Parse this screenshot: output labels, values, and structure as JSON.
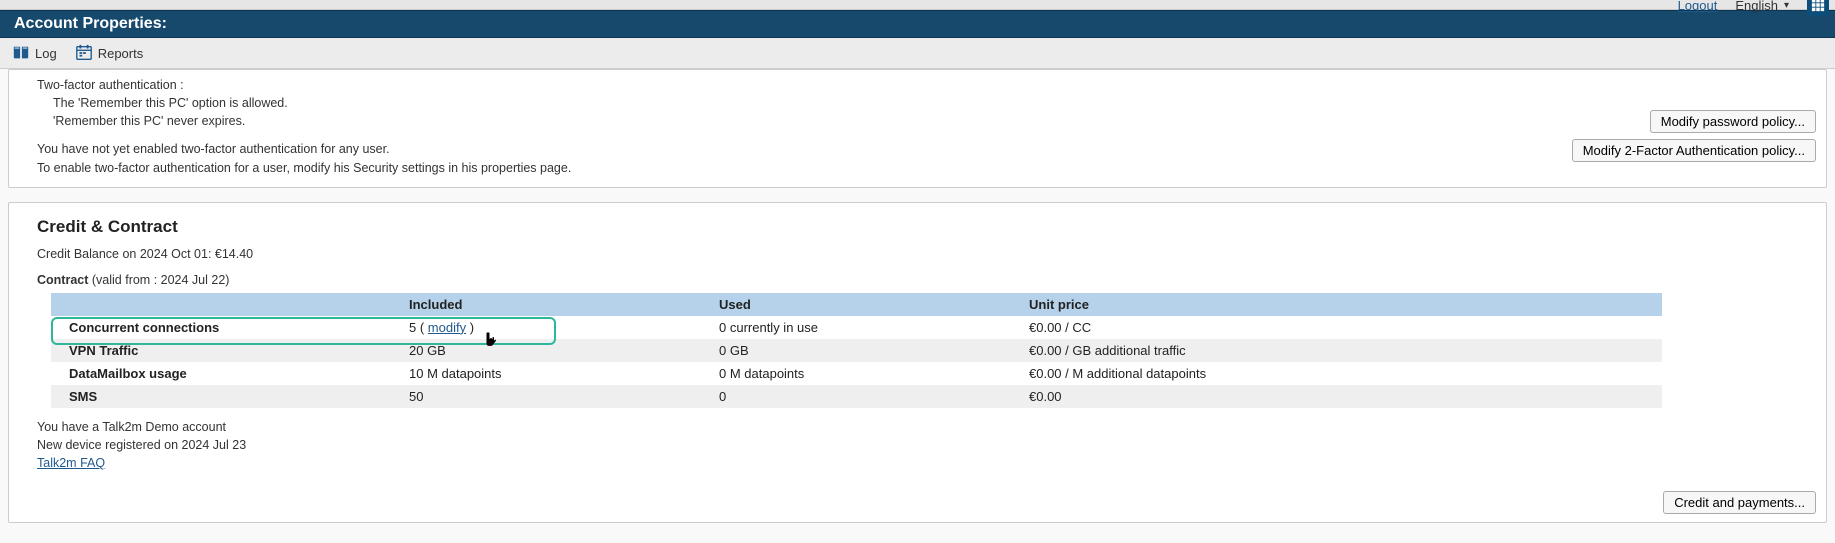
{
  "topbar": {
    "logout": "Logout",
    "language": "English"
  },
  "header": {
    "title": "Account Properties:"
  },
  "toolbar": {
    "log": "Log",
    "reports": "Reports"
  },
  "authPanel": {
    "heading": "Two-factor authentication :",
    "line1": "The 'Remember this PC' option is allowed.",
    "line2": "'Remember this PC' never expires.",
    "info1": "You have not yet enabled two-factor authentication for any user.",
    "info2": "To enable two-factor authentication for a user, modify his Security settings in his properties page.",
    "btn_pw": "Modify password policy...",
    "btn_2fa": "Modify 2-Factor Authentication policy..."
  },
  "credit": {
    "title": "Credit & Contract",
    "balance": "Credit Balance on 2024 Oct 01: €14.40",
    "contract_label": "Contract",
    "contract_valid": " (valid from : 2024 Jul 22)",
    "headers": {
      "included": "Included",
      "used": "Used",
      "unit": "Unit price"
    },
    "rows": [
      {
        "label": "Concurrent connections",
        "bold": true,
        "included_prefix": "5 ( ",
        "included_link": "modify",
        "included_suffix": " )",
        "used": "0 currently in use",
        "unit": "€0.00 / CC"
      },
      {
        "label": "VPN Traffic",
        "bold": true,
        "included": "20 GB",
        "used": "0 GB",
        "unit": "€0.00 / GB additional traffic"
      },
      {
        "label": "DataMailbox usage",
        "bold": true,
        "included": "10 M datapoints",
        "used": "0 M datapoints",
        "unit": "€0.00 / M additional datapoints"
      },
      {
        "label": "SMS",
        "bold": true,
        "included": "50",
        "used": "0",
        "unit": "€0.00"
      }
    ],
    "foot1": "You have a Talk2m Demo account",
    "foot2": "New device registered on 2024 Jul 23",
    "faq": "Talk2m FAQ",
    "btn_credit": "Credit and payments..."
  }
}
